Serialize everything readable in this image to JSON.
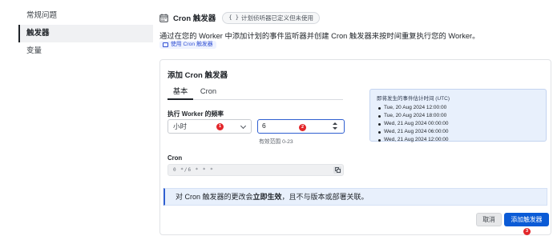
{
  "sidebar": {
    "items": [
      {
        "label": "常规问题"
      },
      {
        "label": "触发器"
      },
      {
        "label": "变量"
      }
    ]
  },
  "header": {
    "icon": "calendar-icon",
    "title": "Cron 触发器",
    "badge": "计划侦听器已定义但未使用",
    "badge_icon": "{ }",
    "description": "通过在您的 Worker 中添加计划的事件监听器并创建 Cron 触发器来按时间重复执行您的 Worker。",
    "doc_link": "使用 Cron 触发器"
  },
  "dialog": {
    "title": "添加 Cron 触发器",
    "tabs": [
      {
        "label": "基本"
      },
      {
        "label": "Cron"
      }
    ],
    "frequency_label": "执行 Worker 的频率",
    "unit_select": {
      "value": "小时"
    },
    "number_input": {
      "value": "6"
    },
    "range_hint": "有效范围 0-23",
    "cron_label": "Cron",
    "cron_expression": "0 */6 * * *",
    "notice": {
      "prefix": "对 Cron 触发器的更改会",
      "bold": "立即生效",
      "suffix": "，且不与版本或部署关联。"
    },
    "cancel_label": "取消",
    "add_label": "添加触发器"
  },
  "upcoming": {
    "title": "即将发生的事件估计时间 (UTC)",
    "times": [
      "Tue, 20 Aug 2024 12:00:00",
      "Tue, 20 Aug 2024 18:00:00",
      "Wed, 21 Aug 2024 00:00:00",
      "Wed, 21 Aug 2024 06:00:00",
      "Wed, 21 Aug 2024 12:00:00"
    ]
  },
  "markers": [
    "1",
    "2",
    "3"
  ],
  "colors": {
    "accent": "#0b5bd6",
    "focus_border": "#2f5fd0",
    "marker": "#e3262a",
    "info_bg": "#e8f0fc"
  }
}
